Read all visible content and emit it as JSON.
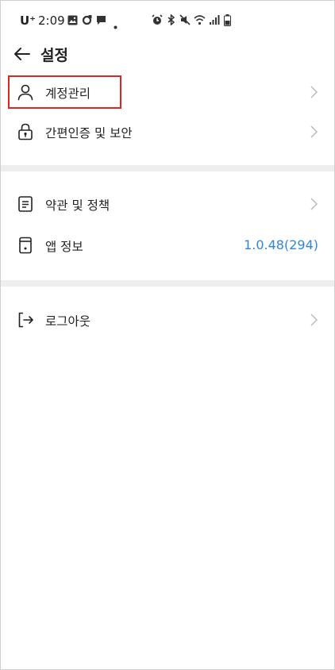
{
  "status_bar": {
    "carrier": "U⁺",
    "time": "2:09",
    "left_icons": [
      "gallery-icon",
      "sync-icon",
      "message-icon",
      "dot-icon"
    ],
    "right_icons": [
      "alarm-icon",
      "bluetooth-icon",
      "mute-icon",
      "wifi-icon",
      "signal-icon",
      "battery-icon"
    ]
  },
  "header": {
    "title": "설정",
    "back_icon": "arrow-left-icon"
  },
  "sections": [
    {
      "items": [
        {
          "label": "계정관리",
          "icon": "person-icon",
          "chevron": true
        },
        {
          "label": "간편인증 및 보안",
          "icon": "lock-icon",
          "chevron": true
        }
      ]
    },
    {
      "items": [
        {
          "label": "약관 및 정책",
          "icon": "document-icon",
          "chevron": true
        },
        {
          "label": "앱 정보",
          "icon": "phone-icon",
          "value": "1.0.48(294)"
        }
      ]
    },
    {
      "items": [
        {
          "label": "로그아웃",
          "icon": "logout-icon",
          "chevron": true
        }
      ]
    }
  ],
  "colors": {
    "accent": "#2f87d6",
    "highlight": "#e02424",
    "divider": "#eeeeee",
    "text": "#222222"
  }
}
